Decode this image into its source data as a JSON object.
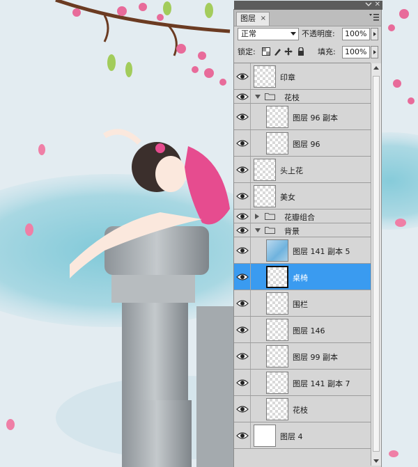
{
  "panel": {
    "tab_label": "图层",
    "tab_close": "×",
    "blend_mode": "正常",
    "opacity_label": "不透明度:",
    "opacity_value": "100%",
    "lock_label": "锁定:",
    "fill_label": "填充:",
    "fill_value": "100%",
    "selection_color": "#3a9bf0"
  },
  "layers": [
    {
      "name": "印章",
      "type": "layer",
      "indent": 0,
      "thumb": "transparent"
    },
    {
      "name": "花枝",
      "type": "group",
      "indent": 0,
      "expanded": true
    },
    {
      "name": "图层 96 副本",
      "type": "layer",
      "indent": 1,
      "thumb": "transparent"
    },
    {
      "name": "图层 96",
      "type": "layer",
      "indent": 1,
      "thumb": "transparent"
    },
    {
      "name": "头上花",
      "type": "layer",
      "indent": 0,
      "thumb": "transparent"
    },
    {
      "name": "美女",
      "type": "layer",
      "indent": 0,
      "thumb": "transparent"
    },
    {
      "name": "花瓣组合",
      "type": "group",
      "indent": 0,
      "expanded": false
    },
    {
      "name": "背景",
      "type": "group",
      "indent": 0,
      "expanded": true
    },
    {
      "name": "图层 141 副本 5",
      "type": "layer",
      "indent": 1,
      "thumb": "blue"
    },
    {
      "name": "桌椅",
      "type": "layer",
      "indent": 1,
      "thumb": "transparent",
      "selected": true
    },
    {
      "name": "围栏",
      "type": "layer",
      "indent": 1,
      "thumb": "transparent"
    },
    {
      "name": "图层 146",
      "type": "layer",
      "indent": 1,
      "thumb": "transparent"
    },
    {
      "name": "图层 99 副本",
      "type": "layer",
      "indent": 1,
      "thumb": "transparent"
    },
    {
      "name": "图层 141 副本 7",
      "type": "layer",
      "indent": 1,
      "thumb": "transparent"
    },
    {
      "name": "花枝",
      "type": "layer",
      "indent": 1,
      "thumb": "transparent"
    },
    {
      "name": "图层 4",
      "type": "layer",
      "indent": 0,
      "thumb": "white"
    }
  ]
}
